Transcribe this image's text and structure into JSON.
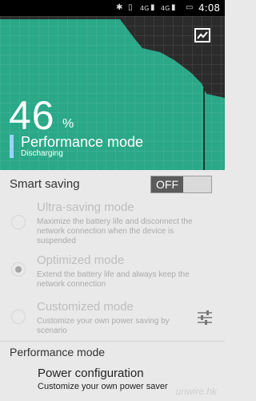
{
  "status": {
    "time": "4:08",
    "network_1": "4G",
    "network_2": "4G"
  },
  "battery": {
    "percent": "46",
    "percent_sign": "%",
    "mode": "Performance mode",
    "state": "Discharging",
    "colors": {
      "fill": "#2aa888",
      "dark": "#2b2b2b",
      "accent": "#9ad3ff"
    }
  },
  "smart_saving": {
    "label": "Smart saving",
    "toggle": "OFF"
  },
  "options": [
    {
      "title": "Ultra-saving mode",
      "desc": "Maximize the battery life and disconnect the network connection when the device is suspended",
      "selected": false
    },
    {
      "title": "Optimized mode",
      "desc": "Extend the battery life and always keep the network connection",
      "selected": true
    },
    {
      "title": "Customized mode",
      "desc": "Customize your own power saving by scenario",
      "selected": false
    }
  ],
  "performance": {
    "section_label": "Performance mode",
    "power_title": "Power configuration",
    "power_desc": "Customize your own power saver"
  },
  "watermark": "unwire.hk"
}
